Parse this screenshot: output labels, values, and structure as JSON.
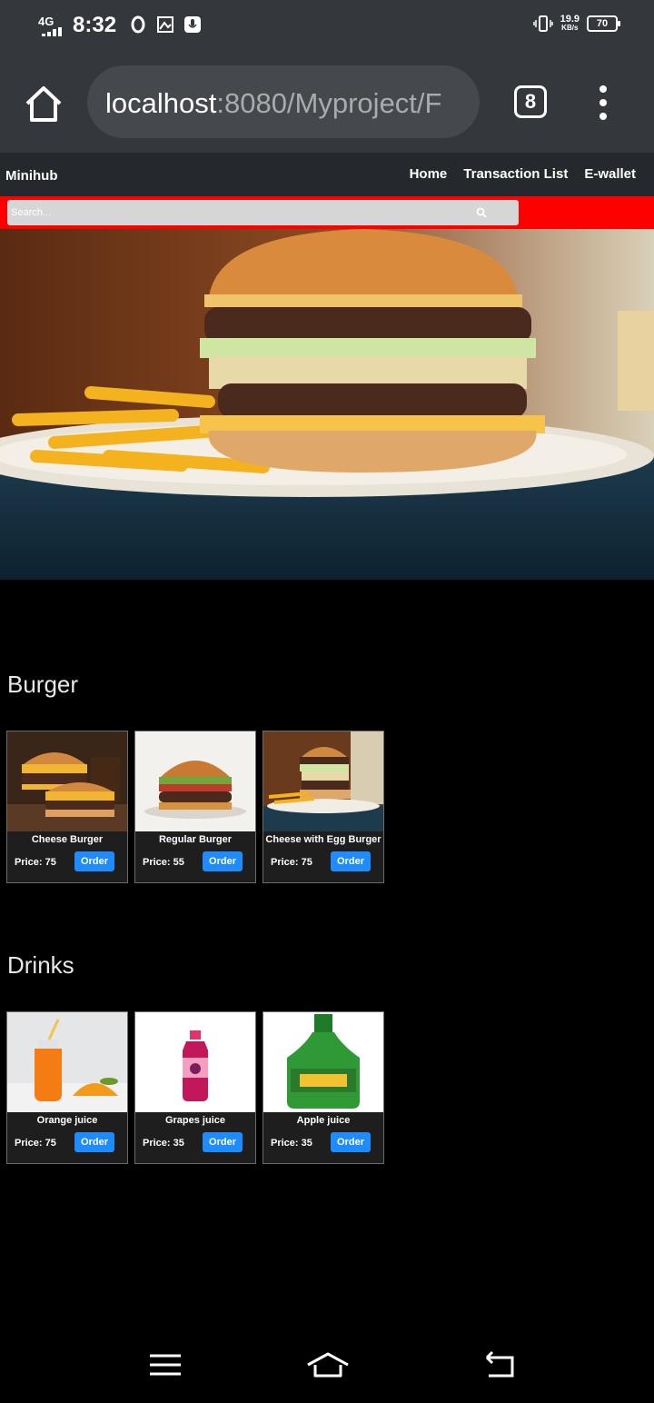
{
  "status": {
    "network": "4G",
    "time": "8:32",
    "speed_value": "19.9",
    "speed_unit": "KB/s",
    "battery": "70"
  },
  "browser": {
    "url_host": "localhost",
    "url_rest": ":8080/Myproject/F",
    "tab_count": "8"
  },
  "site": {
    "brand": "Minihub",
    "nav": [
      "Home",
      "Transaction List",
      "E-wallet"
    ],
    "search_placeholder": "Search..."
  },
  "sections": [
    {
      "title": "Burger",
      "items": [
        {
          "name": "Cheese Burger",
          "price": "Price: 75",
          "action": "Order"
        },
        {
          "name": "Regular Burger",
          "price": "Price: 55",
          "action": "Order"
        },
        {
          "name": "Cheese with Egg Burger",
          "price": "Price: 75",
          "action": "Order"
        }
      ]
    },
    {
      "title": "Drinks",
      "items": [
        {
          "name": "Orange juice",
          "price": "Price: 75",
          "action": "Order"
        },
        {
          "name": "Grapes juice",
          "price": "Price: 35",
          "action": "Order"
        },
        {
          "name": "Apple juice",
          "price": "Price: 35",
          "action": "Order"
        }
      ]
    }
  ],
  "colors": {
    "search_strip": "#ff0000",
    "order_button": "#1e8cff",
    "chrome_bar": "#34373b"
  }
}
